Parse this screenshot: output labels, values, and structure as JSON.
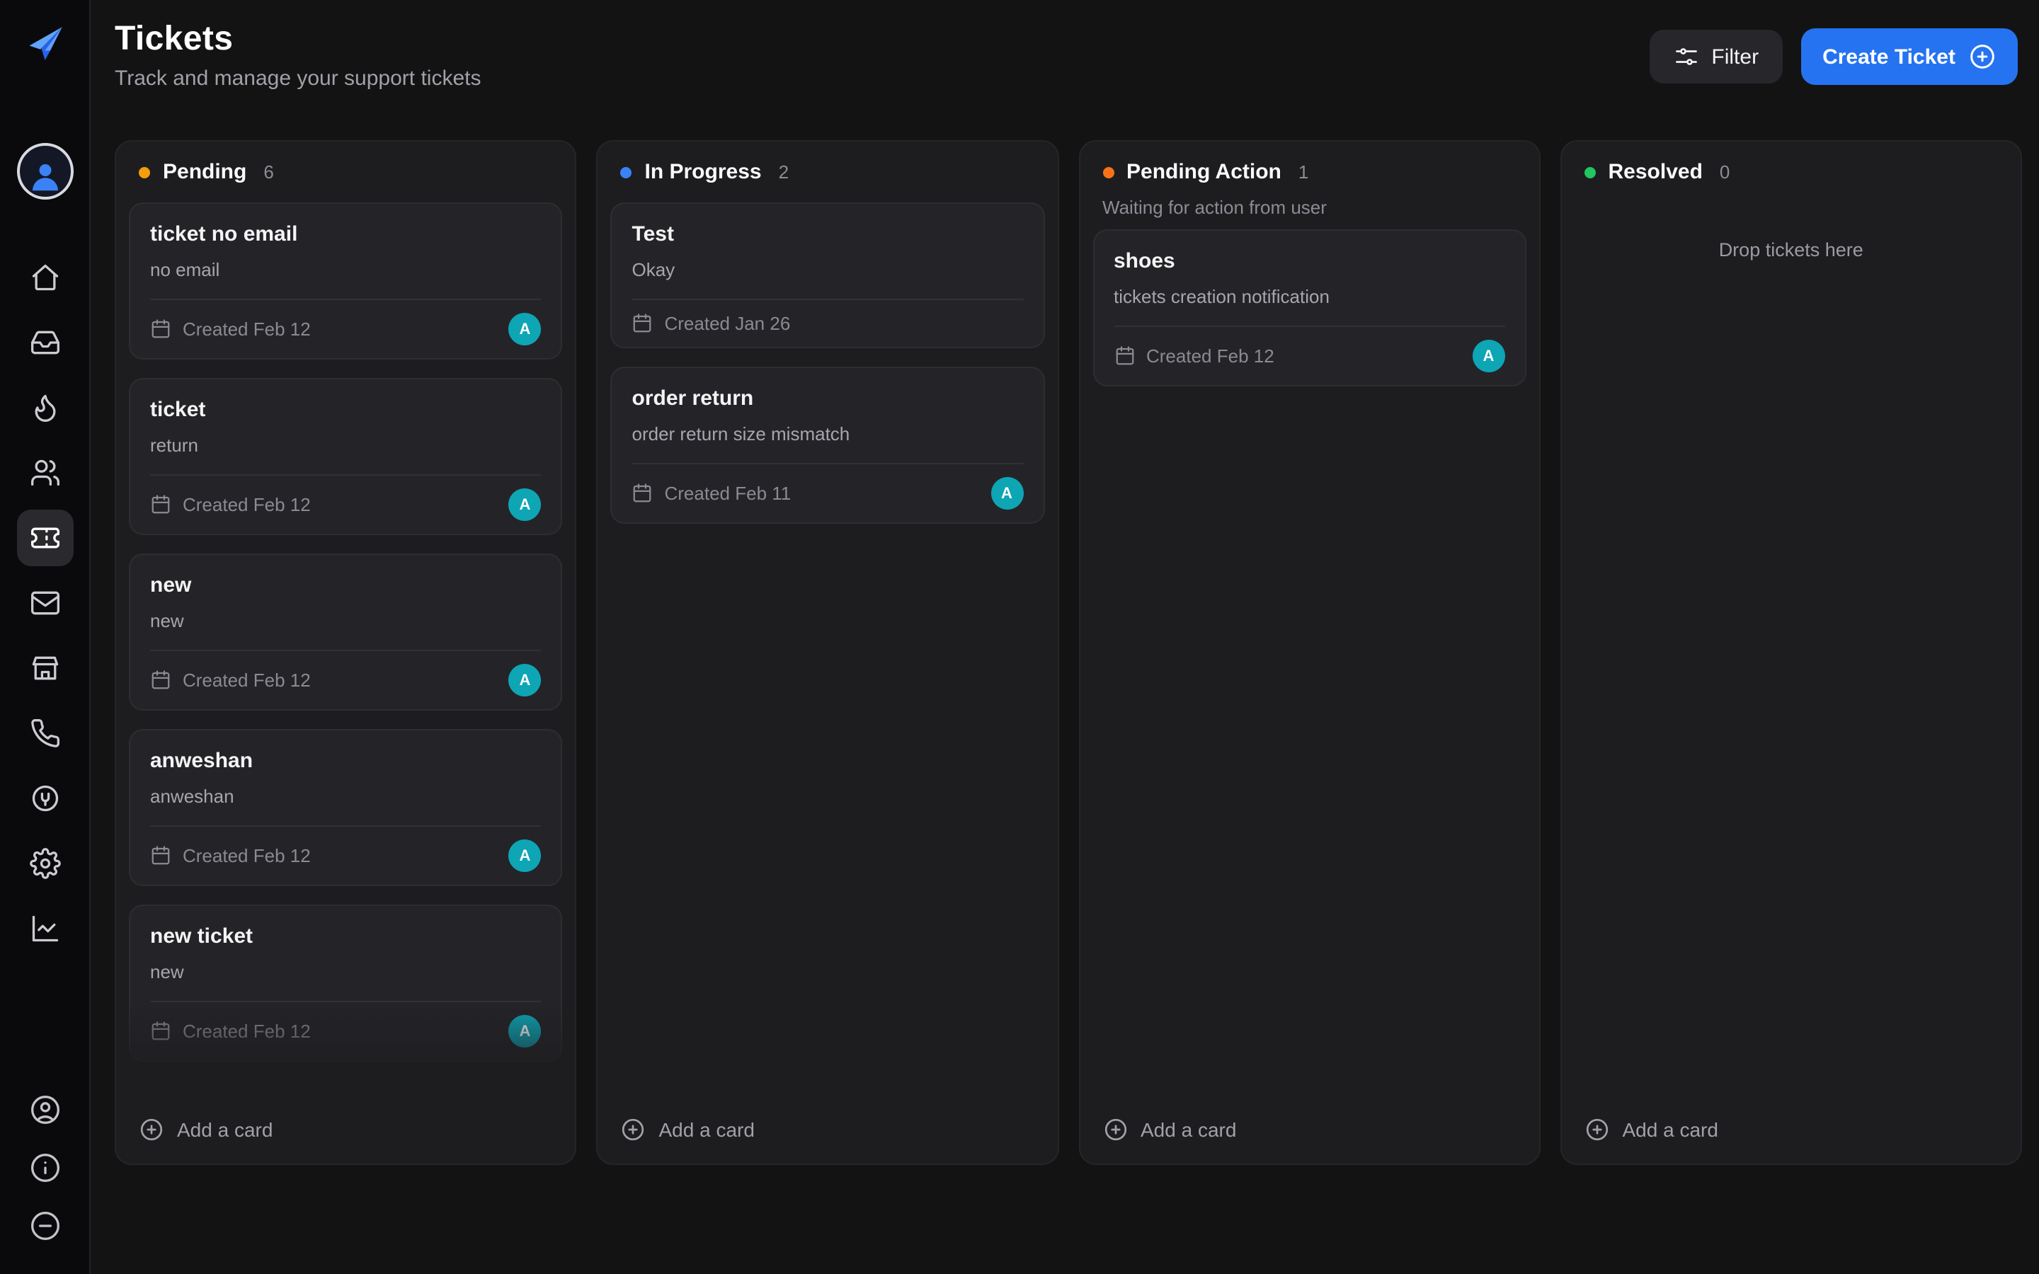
{
  "colors": {
    "accent_blue": "#2573f0",
    "avatar_teal": "#0ea5b5",
    "pending_dot": "#f59e0b",
    "in_progress_dot": "#3b82f6",
    "pending_action_dot": "#f97316",
    "resolved_dot": "#22c55e"
  },
  "header": {
    "title": "Tickets",
    "subtitle": "Track and manage your support tickets",
    "filter_label": "Filter",
    "create_label": "Create Ticket"
  },
  "sidebar": {
    "nav_icons": [
      "home",
      "inbox",
      "flame",
      "users",
      "ticket",
      "mail",
      "store",
      "phone",
      "plug",
      "settings",
      "analytics"
    ],
    "active_icon": "ticket",
    "bottom_icons": [
      "account",
      "info",
      "collapse"
    ]
  },
  "board": {
    "columns": [
      {
        "name": "Pending",
        "count": "6",
        "dot_color": "#f59e0b",
        "add_label": "Add a card",
        "cards": [
          {
            "title": "ticket no email",
            "desc": "no email",
            "created": "Created Feb 12",
            "avatar": "A"
          },
          {
            "title": "ticket",
            "desc": "return",
            "created": "Created Feb 12",
            "avatar": "A"
          },
          {
            "title": "new",
            "desc": "new",
            "created": "Created Feb 12",
            "avatar": "A"
          },
          {
            "title": "anweshan",
            "desc": "anweshan",
            "created": "Created Feb 12",
            "avatar": "A"
          },
          {
            "title": "new ticket",
            "desc": "new",
            "created": "Created Feb 12",
            "avatar": "A"
          }
        ]
      },
      {
        "name": "In Progress",
        "count": "2",
        "dot_color": "#3b82f6",
        "add_label": "Add a card",
        "cards": [
          {
            "title": "Test",
            "desc": "Okay",
            "created": "Created Jan 26"
          },
          {
            "title": "order return",
            "desc": "order return size mismatch",
            "created": "Created Feb 11",
            "avatar": "A"
          }
        ]
      },
      {
        "name": "Pending Action",
        "count": "1",
        "dot_color": "#f97316",
        "subtitle": "Waiting for action from user",
        "add_label": "Add a card",
        "cards": [
          {
            "title": "shoes",
            "desc": "tickets creation notification",
            "created": "Created Feb 12",
            "avatar": "A"
          }
        ]
      },
      {
        "name": "Resolved",
        "count": "0",
        "dot_color": "#22c55e",
        "empty_label": "Drop tickets here",
        "add_label": "Add a card",
        "cards": []
      }
    ]
  }
}
